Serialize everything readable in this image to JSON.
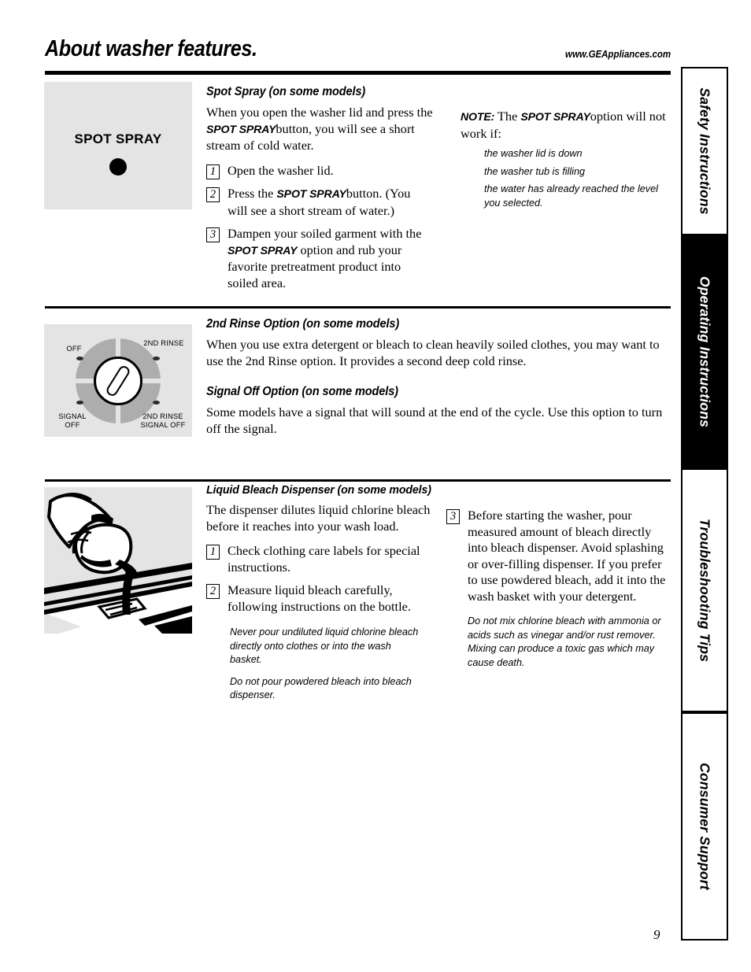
{
  "header": {
    "title": "About washer features.",
    "website": "www.GEAppliances.com"
  },
  "page_number": "9",
  "sections": {
    "spot_spray": {
      "heading": "Spot Spray (on some models)",
      "control_label": "SPOT SPRAY",
      "intro_1": "When you open the washer lid and press",
      "intro_bold": "SPOT SPRAY",
      "intro_2": "the",
      "intro_3": "button, you will see a short stream of cold water.",
      "steps": [
        {
          "num": "1",
          "text": "Open the washer lid."
        },
        {
          "num": "2",
          "text_pre": "Press the",
          "text_bold": "SPOT SPRAY",
          "text_post": "button. (You will see a short stream of water.)"
        },
        {
          "num": "3",
          "text_pre": "Dampen your soiled garment with the",
          "text_bold": "SPOT SPRAY",
          "text_post": "option and rub your favorite pretreatment product into soiled area."
        }
      ],
      "note_label": "NOTE:",
      "note_pre": "The",
      "note_bold": "SPOT SPRAY",
      "note_post": "option will not work if:",
      "note_items": [
        "the washer lid is down",
        "the washer tub is filling",
        "the water has already reached the level you selected."
      ]
    },
    "second_rinse": {
      "heading": "2nd Rinse Option (on some models)",
      "body": "When you use extra detergent or bleach to clean heavily soiled clothes, you may want to use the 2nd Rinse option. It provides a second deep cold rinse."
    },
    "signal_off": {
      "heading": "Signal Off Option (on some models)",
      "body": "Some models have a signal that will sound at the end of the cycle. Use this option to turn off the signal."
    },
    "dial": {
      "label_off": "OFF",
      "label_2nd_rinse": "2ND RINSE",
      "label_signal_off": "SIGNAL OFF",
      "label_both": "2ND RINSE SIGNAL OFF"
    },
    "bleach": {
      "heading": "Liquid Bleach Dispenser (on some models)",
      "intro": "The dispenser dilutes liquid chlorine bleach before it reaches into your wash load.",
      "steps": [
        {
          "num": "1",
          "text": "Check clothing care labels for special instructions."
        },
        {
          "num": "2",
          "text": "Measure liquid bleach carefully, following instructions on the bottle."
        },
        {
          "num": "3",
          "text": "Before starting the washer, pour measured amount of bleach directly into bleach dispenser. Avoid splashing or over-filling dispenser. If you prefer to use powdered bleach, add it into the wash basket with your detergent."
        }
      ],
      "warnings_left": [
        "Never pour undiluted liquid chlorine bleach directly onto clothes or into the wash basket.",
        "Do not pour powdered bleach into bleach dispenser."
      ],
      "warning_right": "Do not mix chlorine bleach with ammonia or acids such as vinegar and/or rust remover. Mixing can produce a toxic gas which may cause death."
    }
  },
  "side_tabs": [
    {
      "label": "Safety Instructions",
      "active": false
    },
    {
      "label": "Operating Instructions",
      "active": true
    },
    {
      "label": "Troubleshooting Tips",
      "active": false
    },
    {
      "label": "Consumer Support",
      "active": false
    }
  ]
}
